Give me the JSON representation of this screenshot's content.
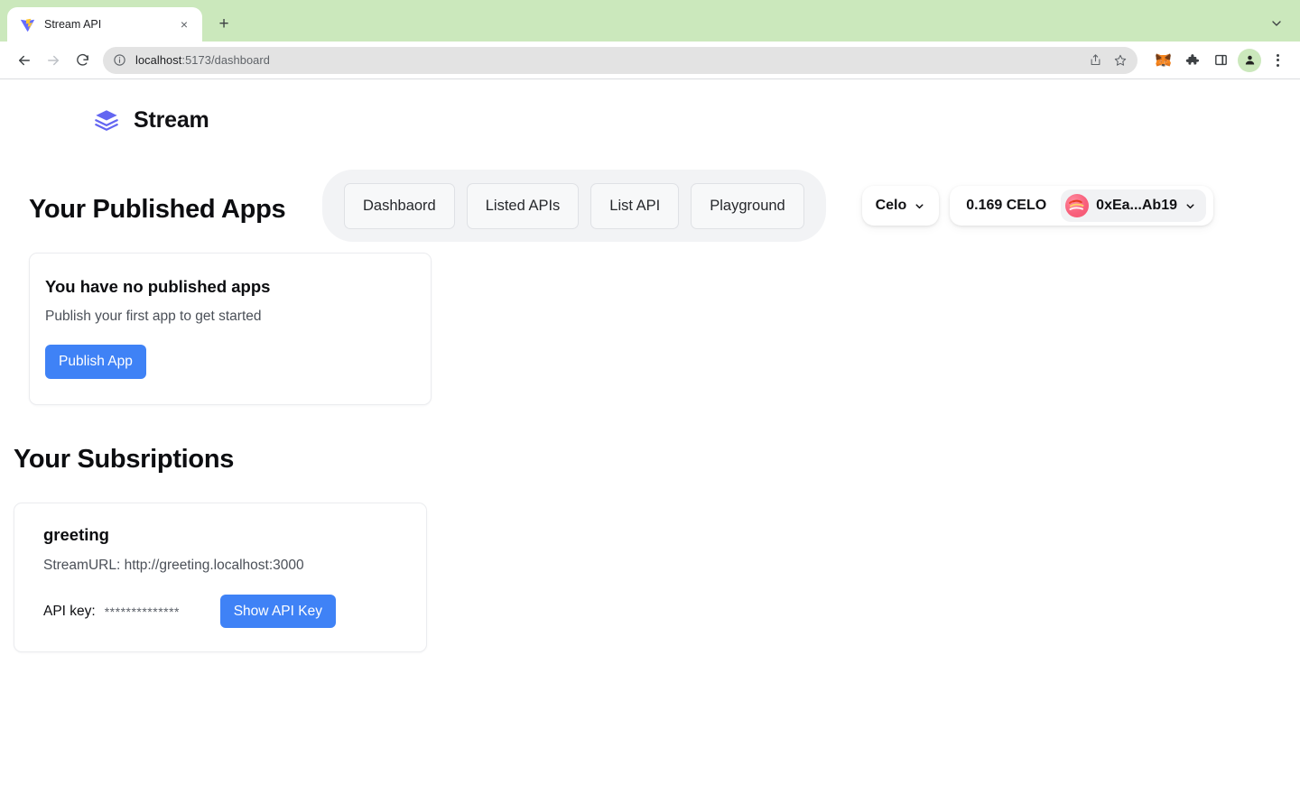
{
  "browser": {
    "tab": {
      "title": "Stream API",
      "favicon_icon": "vite-logo-icon",
      "close_label": "×"
    },
    "new_tab_label": "+",
    "tabstrip_menu_icon": "chevron-down-icon",
    "toolbar": {
      "back_icon": "back-arrow-icon",
      "forward_icon": "forward-arrow-icon",
      "reload_icon": "reload-icon",
      "site_info_icon": "info-circle-icon",
      "url_host": "localhost",
      "url_path": ":5173/dashboard",
      "url_full": "localhost:5173/dashboard",
      "share_icon": "share-icon",
      "bookmark_icon": "star-icon",
      "extension_metamask_icon": "metamask-fox-icon",
      "extensions_icon": "puzzle-piece-icon",
      "side_panel_icon": "side-panel-icon",
      "profile_icon": "profile-avatar-icon",
      "menu_icon": "three-dot-menu-icon"
    }
  },
  "app": {
    "brand": {
      "name": "Stream",
      "logo_icon": "layers-icon",
      "logo_color": "#6366f1"
    },
    "nav": [
      {
        "label": "Dashbaord",
        "name": "nav-dashboard"
      },
      {
        "label": "Listed APIs",
        "name": "nav-listed-apis"
      },
      {
        "label": "List API",
        "name": "nav-list-api"
      },
      {
        "label": "Playground",
        "name": "nav-playground"
      }
    ],
    "wallet": {
      "network": "Celo",
      "network_caret_icon": "chevron-down-icon",
      "balance": "0.169 CELO",
      "address": "0xEa...Ab19",
      "address_caret_icon": "chevron-down-icon",
      "avatar_icon": "account-avatar-icon",
      "avatar_color": "#f4566f"
    },
    "published": {
      "section_title": "Your Published Apps",
      "empty_title": "You have no published apps",
      "empty_subtitle": "Publish your first app to get started",
      "publish_button": "Publish App",
      "button_color": "#3f82f6"
    },
    "subscriptions": {
      "section_title": "Your Subsriptions",
      "items": [
        {
          "name": "greeting",
          "url_label": "StreamURL: http://greeting.localhost:3000",
          "api_key_label": "API key:",
          "api_key_masked": "**************",
          "show_key_button": "Show API Key"
        }
      ]
    }
  }
}
